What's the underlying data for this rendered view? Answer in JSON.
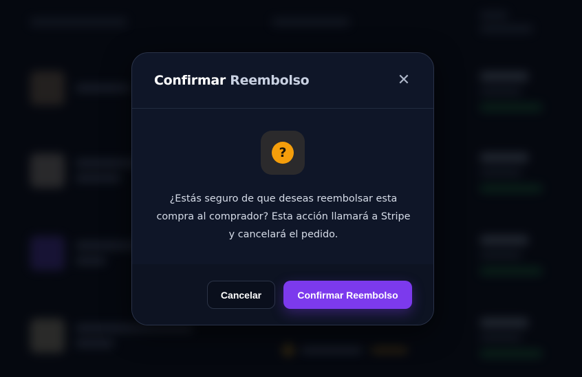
{
  "modal": {
    "title_main": "Confirmar",
    "title_accent": "Reembolso",
    "close_symbol": "✕",
    "icon": "question-mark-icon",
    "icon_glyph": "?",
    "message_lines": [
      "¿Estás seguro de que deseas reembolsar esta",
      "compra al comprador? Esta acción llamará a Stripe",
      "y cancelará el pedido."
    ],
    "cancel_label": "Cancelar",
    "confirm_label": "Confirmar Reembolso"
  },
  "colors": {
    "accent": "#7c3aed",
    "warning": "#f59e0b",
    "modal_bg": "#0f1628"
  }
}
